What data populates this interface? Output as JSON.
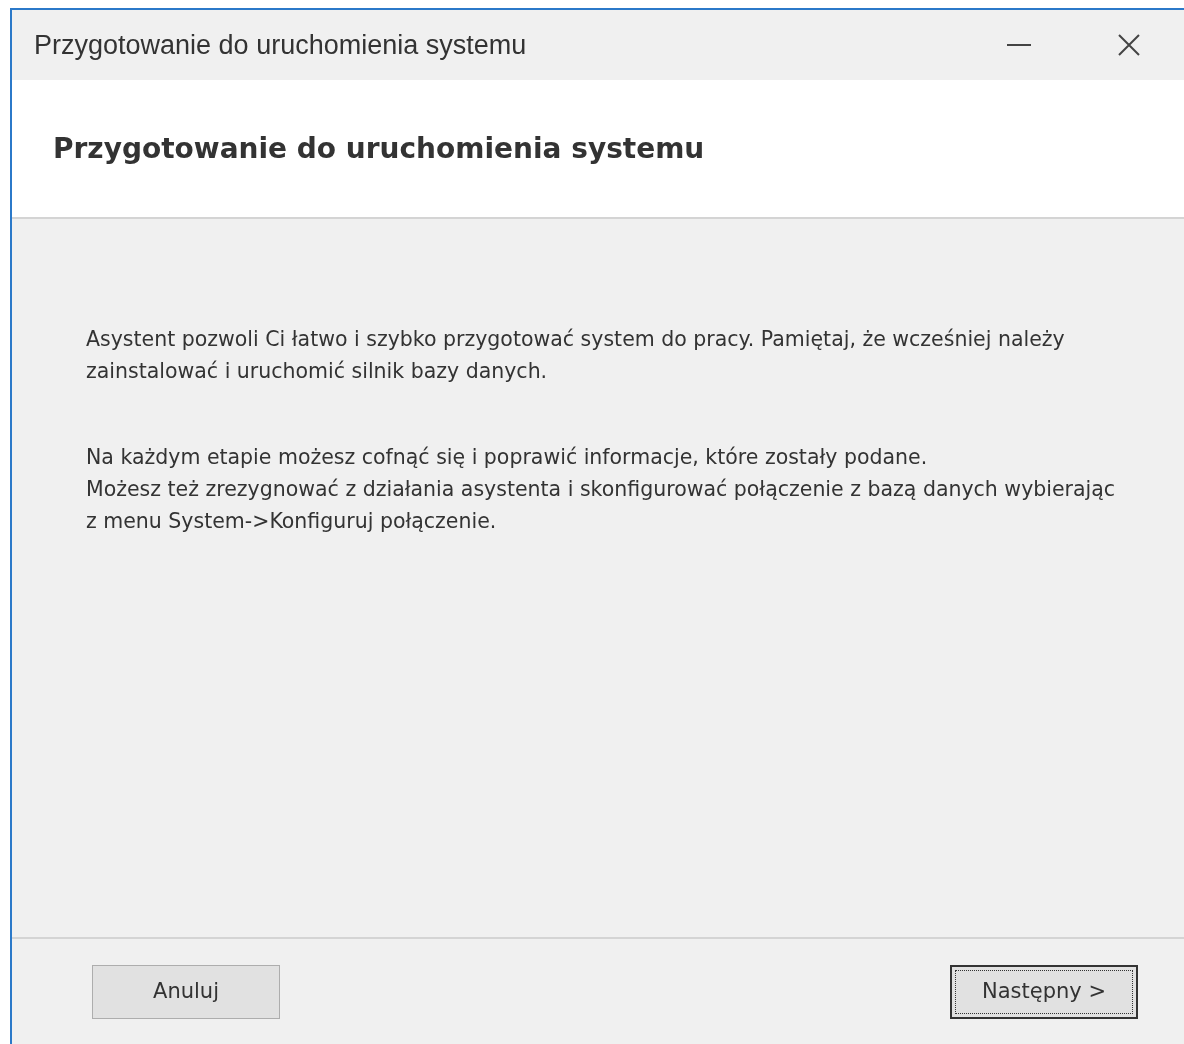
{
  "window": {
    "title": "Przygotowanie do uruchomienia systemu"
  },
  "header": {
    "title": "Przygotowanie do uruchomienia systemu"
  },
  "paragraphs": [
    [
      "Asystent pozwoli Ci łatwo i szybko przygotować system do pracy. Pamiętaj, że wcześniej należy zainstalować i uruchomić silnik bazy danych."
    ],
    [
      "Na każdym etapie możesz cofnąć się i poprawić informacje, które zostały podane.",
      "Możesz też zrezygnować z działania asystenta i skonfigurować połączenie z bazą danych wybierając z menu System->Konfiguruj połączenie."
    ]
  ],
  "buttons": [
    {
      "label": "Anuluj",
      "focused": false
    },
    {
      "label": "Następny >",
      "focused": true
    }
  ]
}
